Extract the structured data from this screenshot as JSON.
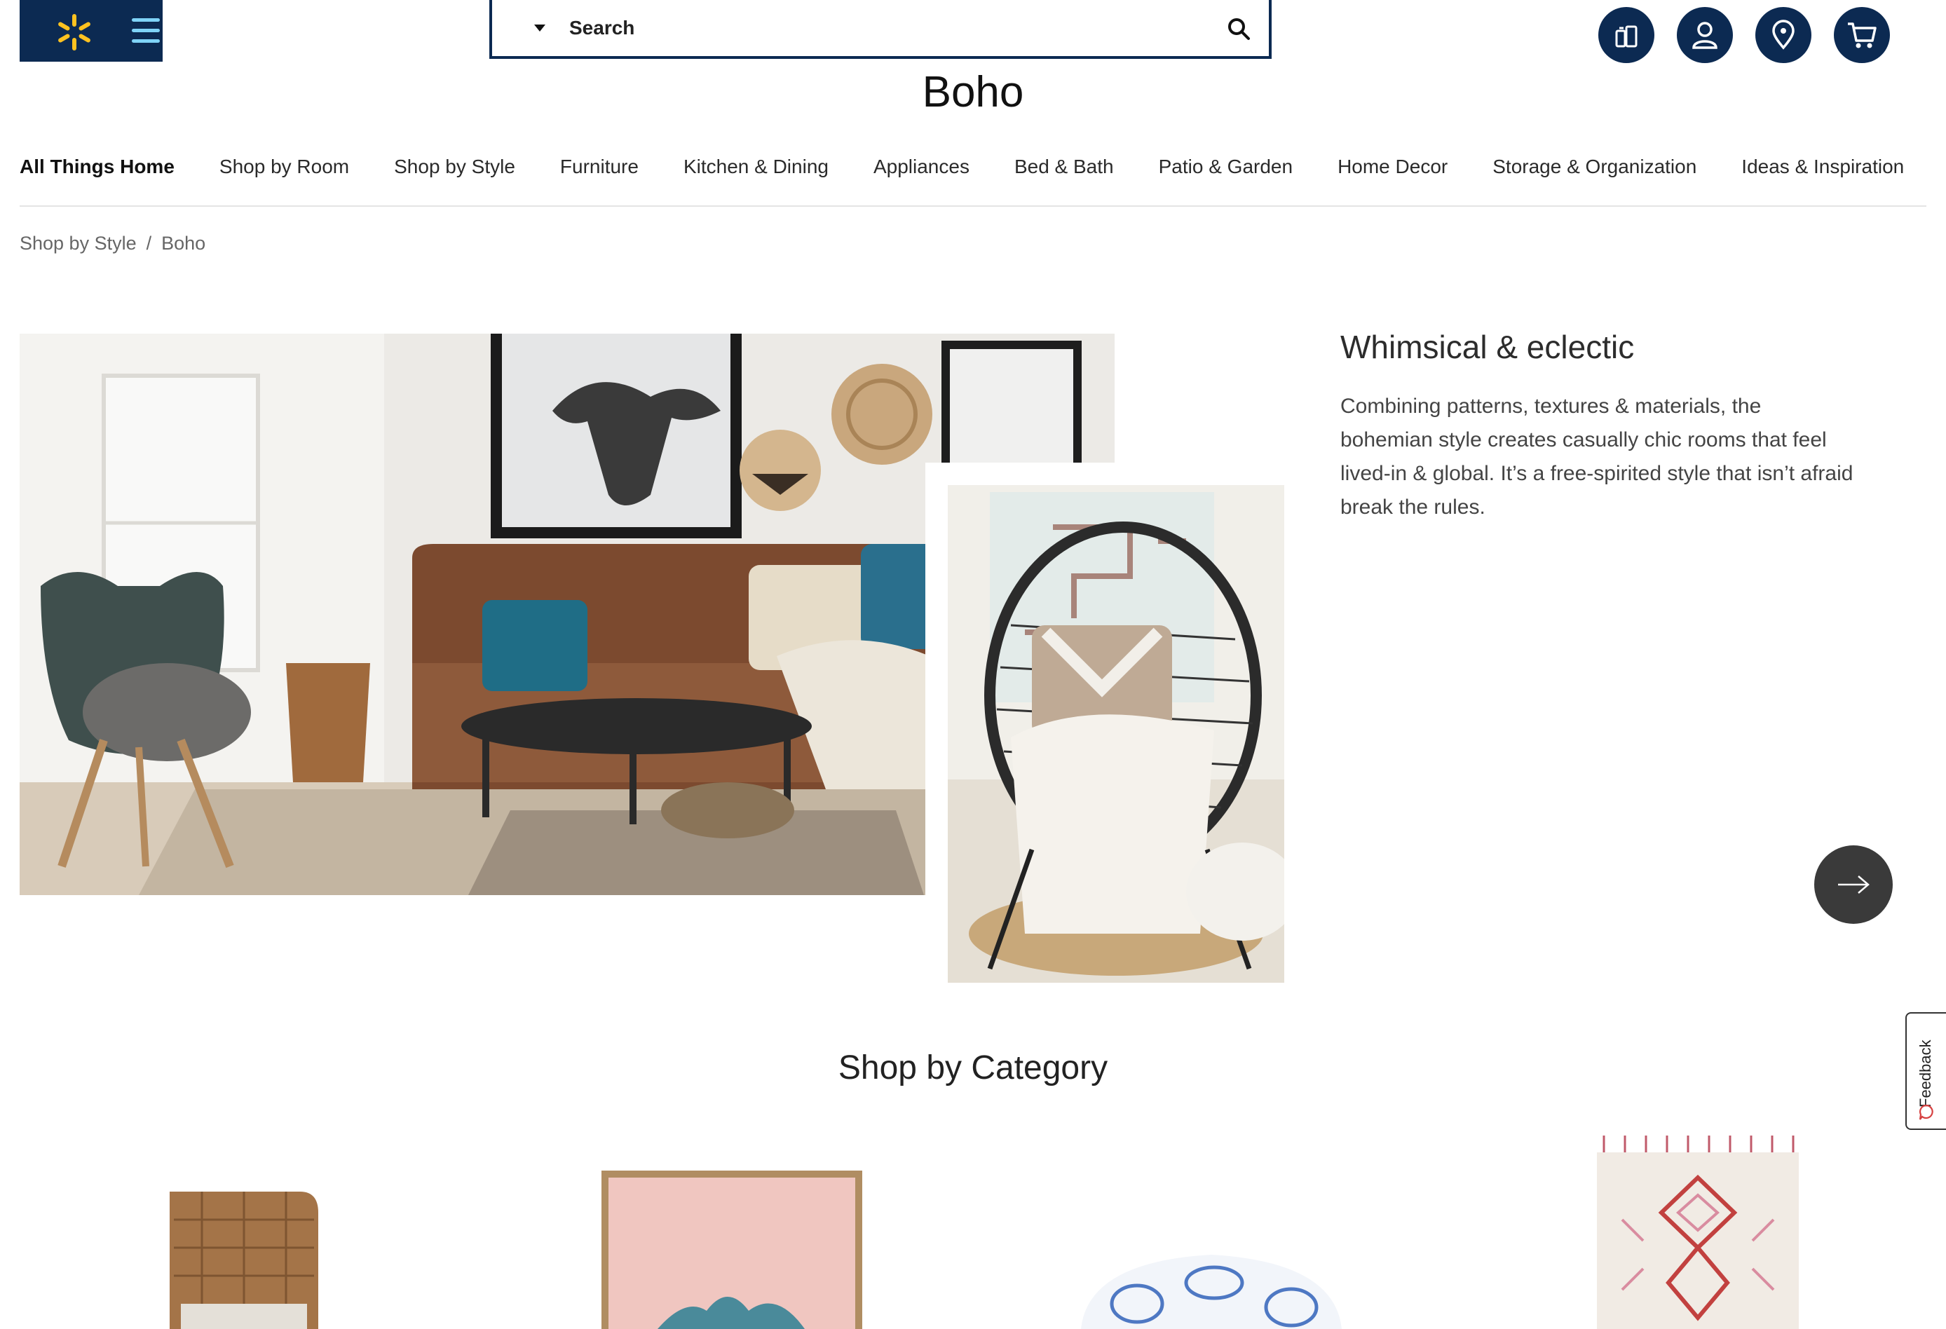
{
  "header": {
    "logo": "walmart-spark-icon",
    "menu_icon": "hamburger-menu-icon",
    "search": {
      "label": "Search",
      "dropdown_icon": "caret-down-icon",
      "search_icon": "magnifier-icon"
    },
    "actions": [
      "reorder-icon",
      "account-icon",
      "location-pin-icon",
      "cart-icon"
    ],
    "colors": {
      "navy": "#0c2a52",
      "spark": "#ffc220",
      "menu": "#7fd3f7"
    }
  },
  "page": {
    "title": "Boho"
  },
  "nav": {
    "items": [
      {
        "label": "All Things Home"
      },
      {
        "label": "Shop by Room"
      },
      {
        "label": "Shop by Style"
      },
      {
        "label": "Furniture"
      },
      {
        "label": "Kitchen & Dining"
      },
      {
        "label": "Appliances"
      },
      {
        "label": "Bed & Bath"
      },
      {
        "label": "Patio & Garden"
      },
      {
        "label": "Home Decor"
      },
      {
        "label": "Storage & Organization"
      },
      {
        "label": "Ideas & Inspiration"
      }
    ]
  },
  "breadcrumb": {
    "parent": "Shop by Style",
    "separator": "/",
    "current": "Boho"
  },
  "hero": {
    "heading": "Whimsical & eclectic",
    "text": "Combining patterns, textures & materials, the bohemian style creates casually chic rooms that feel lived-in & global. It’s a free-spirited style that isn’t afraid break the rules.",
    "next_icon": "arrow-right-icon"
  },
  "feedback": {
    "label": "Feedback"
  },
  "category_section": {
    "title": "Shop by Category"
  }
}
